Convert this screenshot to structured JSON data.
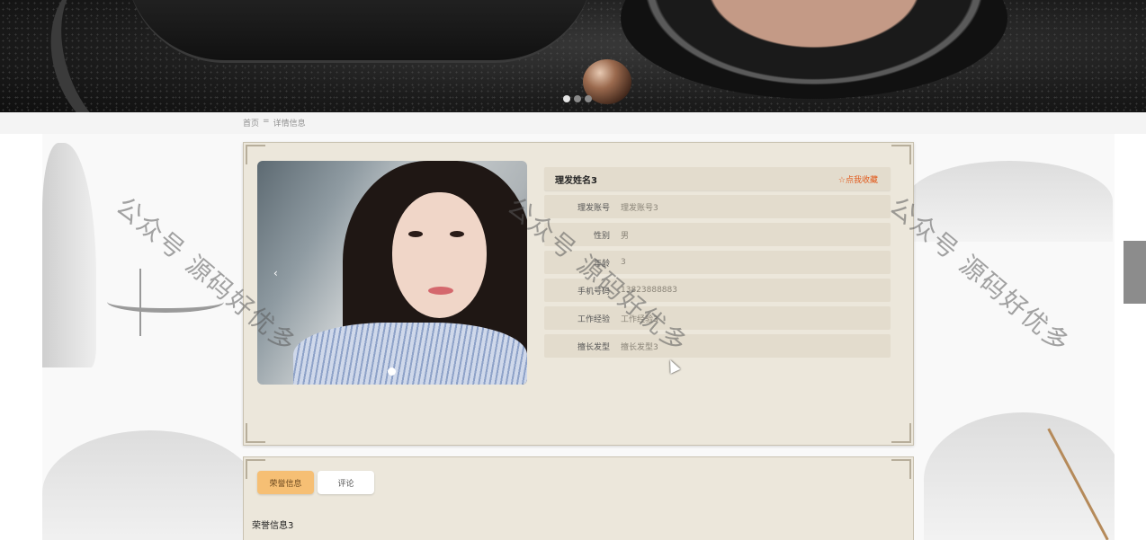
{
  "banner": {
    "slide_count": 3,
    "active_slide": 1
  },
  "breadcrumb": {
    "home": "首页",
    "separator": "=",
    "current": "详情信息"
  },
  "watermark": {
    "text": "公众号 源码好优多"
  },
  "detail": {
    "title": "理发姓名3",
    "favorite_label": "☆点我收藏",
    "fields": [
      {
        "label": "理发账号",
        "value": "理发账号3"
      },
      {
        "label": "性别",
        "value": "男"
      },
      {
        "label": "年龄",
        "value": "3"
      },
      {
        "label": "手机号码",
        "value": "13823888883"
      },
      {
        "label": "工作经验",
        "value": "工作经验3"
      },
      {
        "label": "擅长发型",
        "value": "擅长发型3"
      }
    ],
    "photo_prev_glyph": "‹"
  },
  "tabs": {
    "items": [
      {
        "label": "荣誉信息"
      },
      {
        "label": "评论"
      }
    ],
    "active_index": 0,
    "content": "荣誉信息3"
  },
  "colors": {
    "panel_bg": "#ece7db",
    "row_bg": "#e3dccd",
    "tab_active": "#f6bf74",
    "favorite": "#e25a1c"
  }
}
